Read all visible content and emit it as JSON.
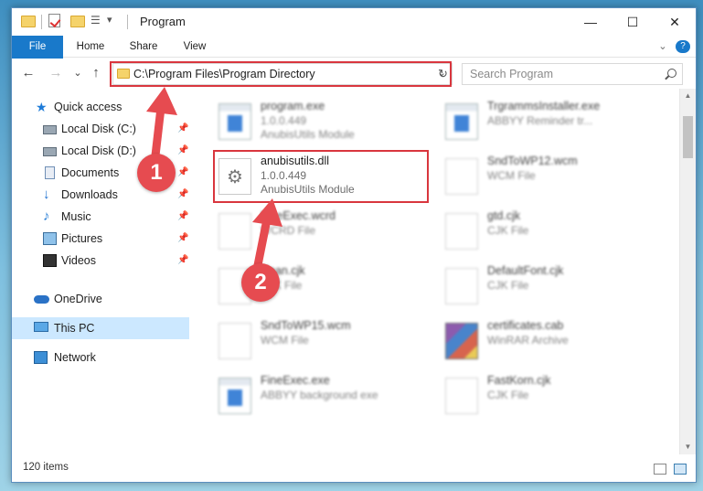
{
  "window": {
    "title": "Program",
    "controls": {
      "minimize": "—",
      "maximize": "☐",
      "close": "✕"
    }
  },
  "quick_access_toolbar": {
    "dropdown": "▾"
  },
  "ribbon": {
    "tabs": [
      "File",
      "Home",
      "Share",
      "View"
    ],
    "expand": "⌄",
    "help": "?"
  },
  "navigation": {
    "back": "←",
    "forward": "→",
    "recent": "⌄",
    "up": "↑",
    "address": "C:\\Program Files\\Program Directory",
    "address_dropdown": "⌄",
    "refresh": "↻",
    "search_placeholder": "Search Program"
  },
  "sidebar": {
    "items": [
      {
        "label": "Quick access",
        "icon": "star-icon",
        "pinned": false
      },
      {
        "label": "Local Disk (C:)",
        "icon": "disk-icon",
        "pinned": true
      },
      {
        "label": "Local Disk (D:)",
        "icon": "disk-icon",
        "pinned": true
      },
      {
        "label": "Documents",
        "icon": "documents-icon",
        "pinned": true
      },
      {
        "label": "Downloads",
        "icon": "downloads-icon",
        "pinned": true
      },
      {
        "label": "Music",
        "icon": "music-icon",
        "pinned": true
      },
      {
        "label": "Pictures",
        "icon": "pictures-icon",
        "pinned": true
      },
      {
        "label": "Videos",
        "icon": "videos-icon",
        "pinned": true
      },
      {
        "label": "OneDrive",
        "icon": "onedrive-icon",
        "pinned": false
      },
      {
        "label": "This PC",
        "icon": "pc-icon",
        "pinned": false,
        "selected": true
      },
      {
        "label": "Network",
        "icon": "network-icon",
        "pinned": false
      }
    ],
    "pin_glyph": "📌"
  },
  "files": {
    "left": [
      {
        "name": "program.exe",
        "line1": "1.0.0.449",
        "line2": "AnubisUtils Module",
        "type": "exe",
        "blurred": true
      },
      {
        "name": "anubisutils.dll",
        "line1": "1.0.0.449",
        "line2": "AnubisUtils Module",
        "type": "gear",
        "blurred": false,
        "highlighted": true
      },
      {
        "name": "FineExec.wcrd",
        "line1": "WCRD File",
        "line2": "",
        "type": "blank",
        "blurred": true
      },
      {
        "name": "clean.cjk",
        "line1": "CJK File",
        "line2": "",
        "type": "blank",
        "blurred": true
      },
      {
        "name": "SndToWP15.wcm",
        "line1": "WCM File",
        "line2": "",
        "type": "blank",
        "blurred": true
      },
      {
        "name": "FineExec.exe",
        "line1": "ABBYY background exe",
        "line2": "",
        "type": "exe",
        "blurred": true
      }
    ],
    "right": [
      {
        "name": "TrgrammsInstaller.exe",
        "line1": "ABBYY Reminder tr...",
        "line2": "",
        "type": "exe",
        "blurred": true
      },
      {
        "name": "SndToWP12.wcm",
        "line1": "WCM File",
        "line2": "",
        "type": "blank",
        "blurred": true
      },
      {
        "name": "gtd.cjk",
        "line1": "CJK File",
        "line2": "",
        "type": "blank",
        "blurred": true
      },
      {
        "name": "DefaultFont.cjk",
        "line1": "CJK File",
        "line2": "",
        "type": "blank",
        "blurred": true
      },
      {
        "name": "certificates.cab",
        "line1": "WinRAR Archive",
        "line2": "",
        "type": "cab",
        "blurred": true
      },
      {
        "name": "FastKorn.cjk",
        "line1": "CJK File",
        "line2": "",
        "type": "blank",
        "blurred": true
      }
    ]
  },
  "status": {
    "items": "120 items"
  },
  "annotations": {
    "step1": "1",
    "step2": "2",
    "color": "#e64b50"
  }
}
